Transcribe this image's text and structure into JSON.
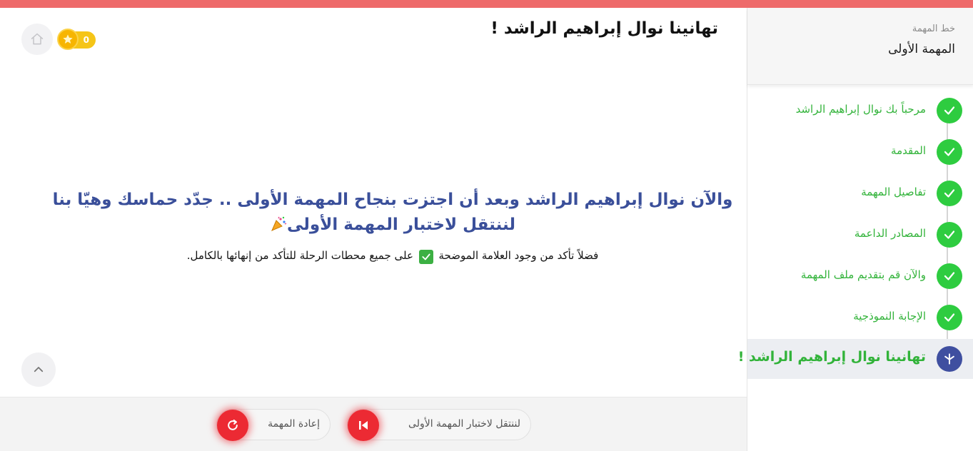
{
  "page": {
    "title": "تهانينا نوال إبراهيم الراشد !",
    "coins": "0"
  },
  "sidebar": {
    "track_label": "خط المهمة",
    "track_title": "المهمة الأولى",
    "steps": [
      {
        "label": "مرحباً بك نوال إبراهيم الراشد",
        "status": "done"
      },
      {
        "label": "المقدمة",
        "status": "done"
      },
      {
        "label": "تفاصيل المهمة",
        "status": "done"
      },
      {
        "label": "المصادر الداعمة",
        "status": "done"
      },
      {
        "label": "والآن قم بتقديم ملف المهمة",
        "status": "done"
      },
      {
        "label": "الإجابة النموذجية",
        "status": "done"
      },
      {
        "label": "تهانينا نوال إبراهيم الراشد !",
        "status": "current"
      }
    ]
  },
  "content": {
    "headline_line1": "والآن نوال إبراهيم الراشد وبعد أن اجتزت بنجاح المهمة الأولى .. جدّد حماسك وهيّا بنا",
    "headline_line2": "لننتقل لاختبار المهمة الأولى",
    "note_before": "فضلاً تأكد من وجود العلامة الموضحة",
    "note_after": "على جميع محطات الرحلة للتأكد من إنهائها بالكامل."
  },
  "footer": {
    "next_label": "لننتقل لاختبار المهمة الأولى",
    "retry_label": "إعادة المهمة"
  },
  "colors": {
    "top_bar": "#ee6a6a",
    "done_green": "#2ecc40",
    "current_blue": "#3f4fa0",
    "headline_blue": "#3a4f9a",
    "action_red": "#ec2a33",
    "coin_gold": "#f5c518"
  },
  "icons": {
    "home": "home-icon",
    "coin": "star-coin-icon",
    "step_done": "check-icon",
    "step_current": "person-icon",
    "scroll_up": "chevron-up-icon",
    "next": "skip-back-icon",
    "retry": "refresh-icon",
    "celebration": "party-popper-icon",
    "checkmark": "checkbox-icon"
  }
}
